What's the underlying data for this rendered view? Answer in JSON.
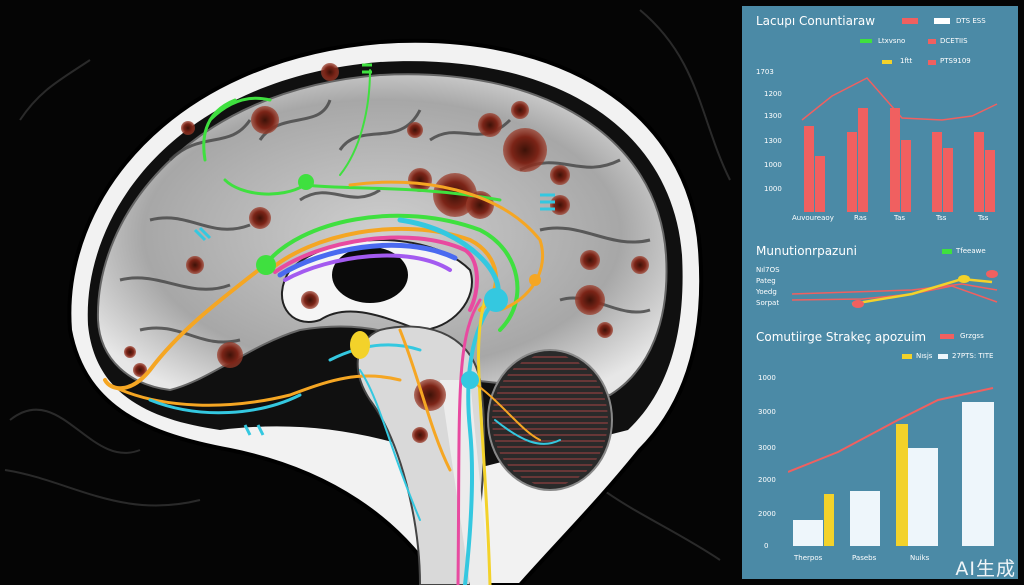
{
  "image": {
    "description_free": true
  },
  "panel": {
    "top": {
      "title": "Lacupı Conuntiaraw",
      "legend": [
        "DTS ESS",
        "Ltxvsno",
        "DCETIIS",
        "1ftt",
        "PTS9109"
      ],
      "y_ticks": [
        "1703",
        "1200",
        "1300",
        "1300",
        "1000",
        "1000"
      ],
      "x_labels": [
        "Auvoureaoy",
        "Ras",
        "Tas",
        "Tss",
        "Tss"
      ]
    },
    "middle": {
      "title": "Munutionrpazuni",
      "legend": [
        "Tfeeawe"
      ],
      "y_ticks": [
        "Nıl7OS",
        "Pateg",
        "Yoedg",
        "Sorpat"
      ]
    },
    "bottom": {
      "title": "Comutiirge Strakeç apozuim",
      "legend": [
        "Grzgss",
        "Nısjs",
        "27PTS: TITE"
      ],
      "y_ticks": [
        "1000",
        "3000",
        "3000",
        "2000",
        "2000",
        "0"
      ],
      "x_labels": [
        "Therpos",
        "Pasebs",
        "Nuiks"
      ]
    }
  },
  "colors": {
    "panel_bg": "#4b8aa6",
    "red": "#f06060",
    "yellow": "#f3d22a",
    "white": "#eef6fb",
    "cyan": "#34c8e0",
    "green": "#3fe03f",
    "orange": "#f5a623"
  },
  "watermark": "AI生成"
}
